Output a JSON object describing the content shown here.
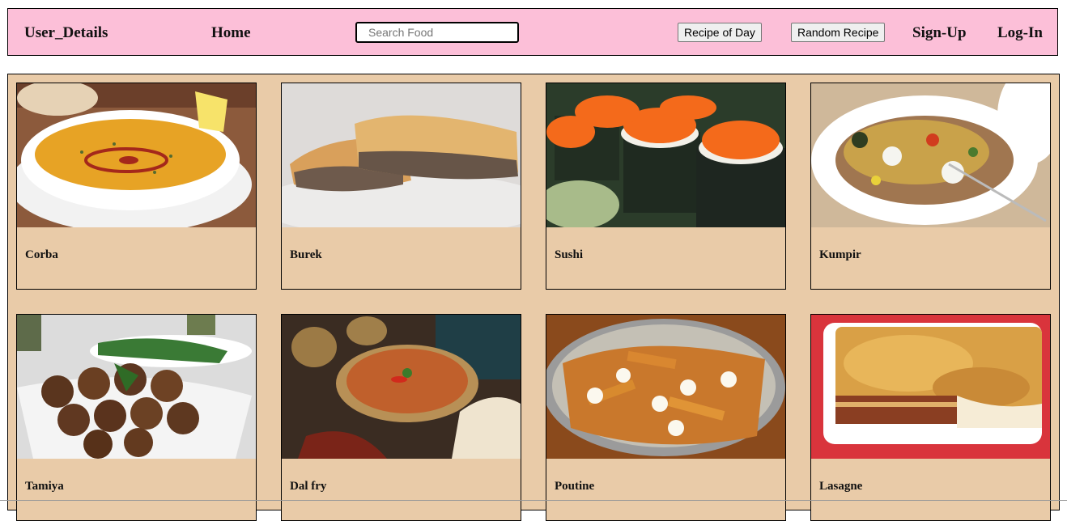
{
  "nav": {
    "user_details": "User_Details",
    "home": "Home",
    "search_placeholder": "Search Food",
    "recipe_of_day": "Recipe of Day",
    "random_recipe": "Random Recipe",
    "sign_up": "Sign-Up",
    "log_in": "Log-In"
  },
  "colors": {
    "nav_bg": "#fcbfd8",
    "content_bg": "#e9cba8"
  },
  "foods": [
    {
      "name": "Corba",
      "image": "lentil-soup-photo"
    },
    {
      "name": "Burek",
      "image": "burek-pastry-photo"
    },
    {
      "name": "Sushi",
      "image": "sushi-rolls-photo"
    },
    {
      "name": "Kumpir",
      "image": "stuffed-potato-photo"
    },
    {
      "name": "Tamiya",
      "image": "falafel-photo"
    },
    {
      "name": "Dal fry",
      "image": "dal-curry-photo"
    },
    {
      "name": "Poutine",
      "image": "poutine-photo"
    },
    {
      "name": "Lasagne",
      "image": "lasagne-photo"
    }
  ]
}
